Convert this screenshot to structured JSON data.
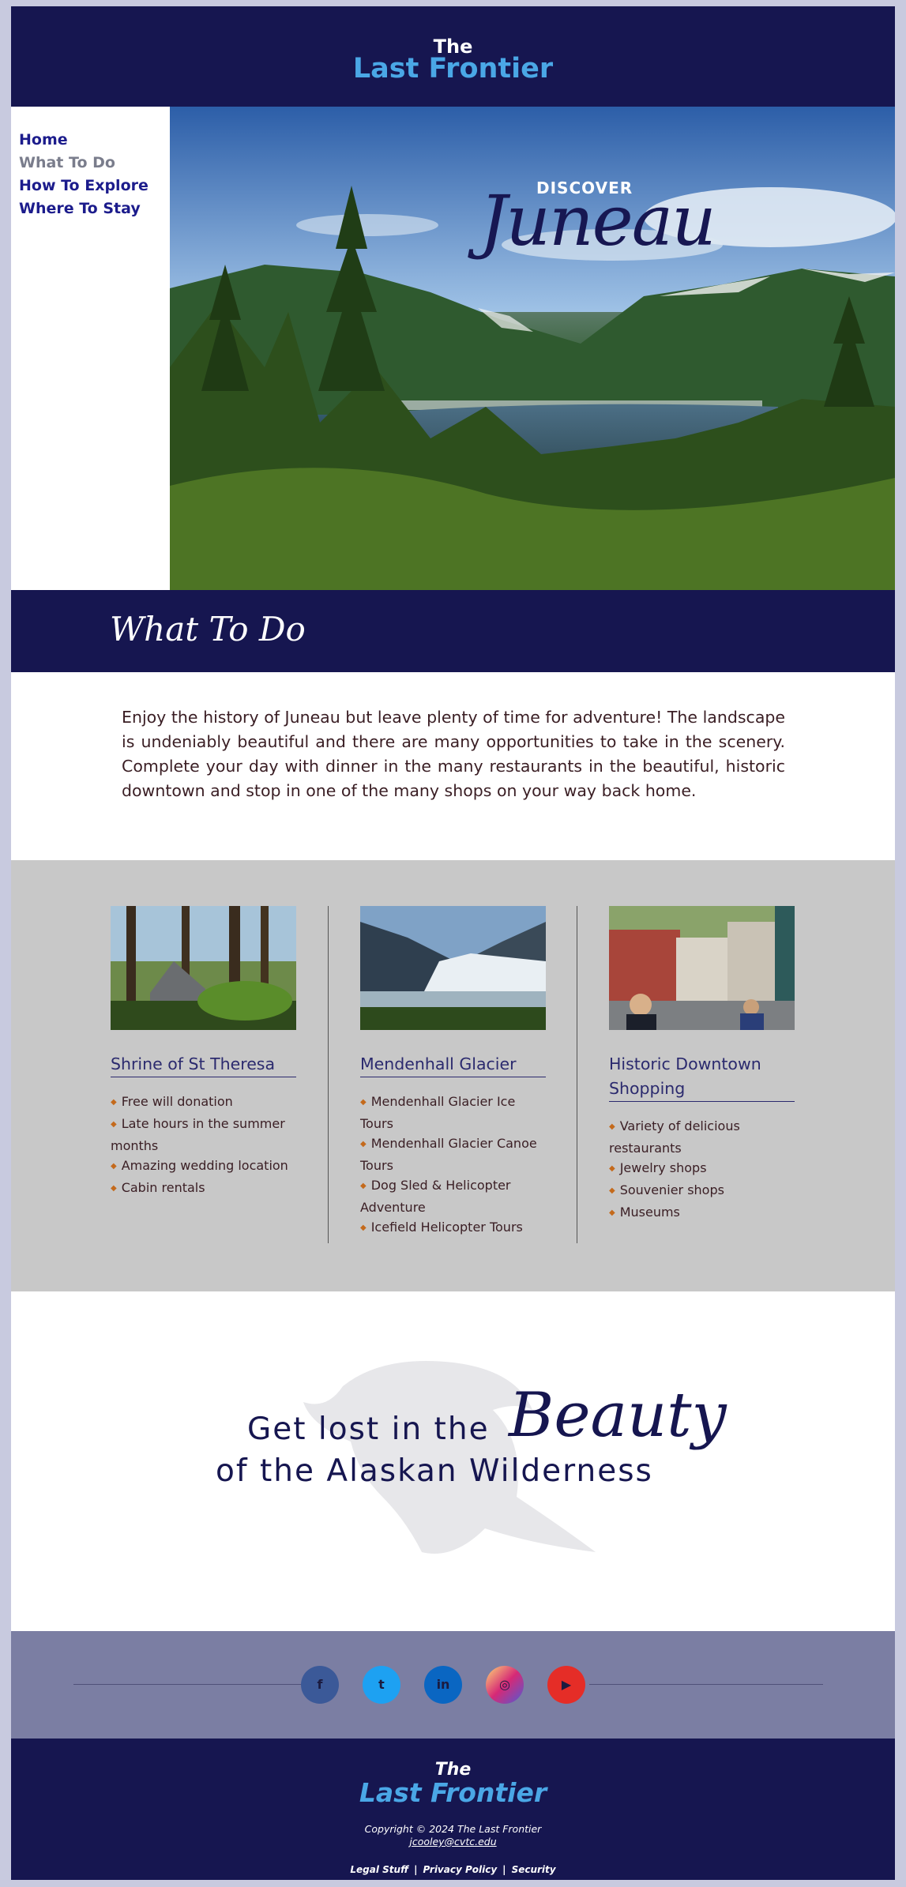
{
  "header": {
    "brand_line1": "The",
    "brand_line2": "Last Frontier"
  },
  "nav": [
    {
      "label": "Home"
    },
    {
      "label": "What To Do"
    },
    {
      "label": "How To Explore"
    },
    {
      "label": "Where To Stay"
    }
  ],
  "hero": {
    "kicker": "DISCOVER",
    "title": "Juneau"
  },
  "section": {
    "title": "What To Do",
    "intro": "Enjoy the history of Juneau but leave plenty of time for adventure! The landscape is undeniably beautiful and there are many opportunities to take in the scenery. Complete your day with dinner in the many restaurants in the beautiful, historic downtown and stop in one of the many shops on your way back home."
  },
  "cards": [
    {
      "title": "Shrine of St Theresa",
      "items": [
        "Free will donation",
        "Late hours in the summer months",
        "Amazing wedding location",
        "Cabin rentals"
      ]
    },
    {
      "title": "Mendenhall Glacier",
      "items": [
        "Mendenhall Glacier Ice Tours",
        "Mendenhall Glacier Canoe Tours",
        "Dog Sled & Helicopter Adventure",
        "Icefield Helicopter Tours"
      ]
    },
    {
      "title": "Historic Downtown Shopping",
      "items": [
        "Variety of delicious restaurants",
        "Jewelry shops",
        "Souvenier shops",
        "Museums"
      ]
    }
  ],
  "tagline": {
    "line1": "Get lost in the",
    "accent": "Beauty",
    "line2": "of the Alaskan Wilderness"
  },
  "social": {
    "icons": [
      {
        "name": "facebook-icon",
        "glyph": "f",
        "color": "#3b5998"
      },
      {
        "name": "twitter-icon",
        "glyph": "t",
        "color": "#1da1f2"
      },
      {
        "name": "linkedin-icon",
        "glyph": "in",
        "color": "#0a66c2"
      },
      {
        "name": "instagram-icon",
        "glyph": "◎",
        "color": "#d62976"
      },
      {
        "name": "youtube-icon",
        "glyph": "▶",
        "color": "#e52d27"
      }
    ]
  },
  "footer": {
    "brand_line1": "The",
    "brand_line2": "Last Frontier",
    "copyright": "Copyright © 2024 The Last Frontier",
    "email": "jcooley@cvtc.edu",
    "links": [
      "Legal Stuff",
      "Privacy Policy",
      "Security"
    ],
    "separator": "|"
  },
  "colors": {
    "navy": "#161650",
    "brand_blue": "#4aa7e6",
    "grey_band": "#c8c8c8",
    "social_band": "#7b7ea3"
  }
}
